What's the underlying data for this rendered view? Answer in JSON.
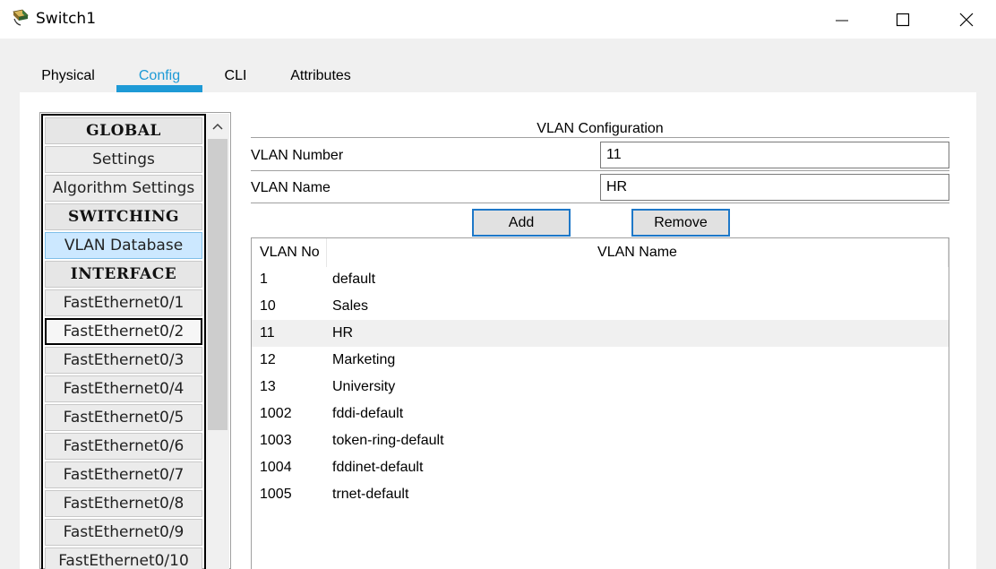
{
  "window": {
    "title": "Switch1"
  },
  "tabs": [
    {
      "label": "Physical"
    },
    {
      "label": "Config"
    },
    {
      "label": "CLI"
    },
    {
      "label": "Attributes"
    }
  ],
  "active_tab": "Config",
  "sidebar": {
    "items": [
      {
        "label": "GLOBAL",
        "kind": "header"
      },
      {
        "label": "Settings"
      },
      {
        "label": "Algorithm Settings"
      },
      {
        "label": "SWITCHING",
        "kind": "header"
      },
      {
        "label": "VLAN Database",
        "state": "selected"
      },
      {
        "label": "INTERFACE",
        "kind": "header"
      },
      {
        "label": "FastEthernet0/1"
      },
      {
        "label": "FastEthernet0/2",
        "state": "focused"
      },
      {
        "label": "FastEthernet0/3"
      },
      {
        "label": "FastEthernet0/4"
      },
      {
        "label": "FastEthernet0/5"
      },
      {
        "label": "FastEthernet0/6"
      },
      {
        "label": "FastEthernet0/7"
      },
      {
        "label": "FastEthernet0/8"
      },
      {
        "label": "FastEthernet0/9"
      },
      {
        "label": "FastEthernet0/10"
      }
    ]
  },
  "vlan_config": {
    "title": "VLAN Configuration",
    "number_label": "VLAN Number",
    "number_value": "11",
    "name_label": "VLAN Name",
    "name_value": "HR",
    "add_label": "Add",
    "remove_label": "Remove"
  },
  "vlan_table": {
    "columns": [
      "VLAN No",
      "VLAN Name"
    ],
    "rows": [
      {
        "no": "1",
        "name": "default"
      },
      {
        "no": "10",
        "name": "Sales"
      },
      {
        "no": "11",
        "name": "HR",
        "highlighted": true
      },
      {
        "no": "12",
        "name": "Marketing"
      },
      {
        "no": "13",
        "name": "University"
      },
      {
        "no": "1002",
        "name": "fddi-default"
      },
      {
        "no": "1003",
        "name": "token-ring-default"
      },
      {
        "no": "1004",
        "name": "fddinet-default"
      },
      {
        "no": "1005",
        "name": "trnet-default"
      }
    ]
  },
  "colors": {
    "accent": "#1e9ad6",
    "selected_item": "#cce8ff",
    "button_border": "#1e78c8"
  }
}
